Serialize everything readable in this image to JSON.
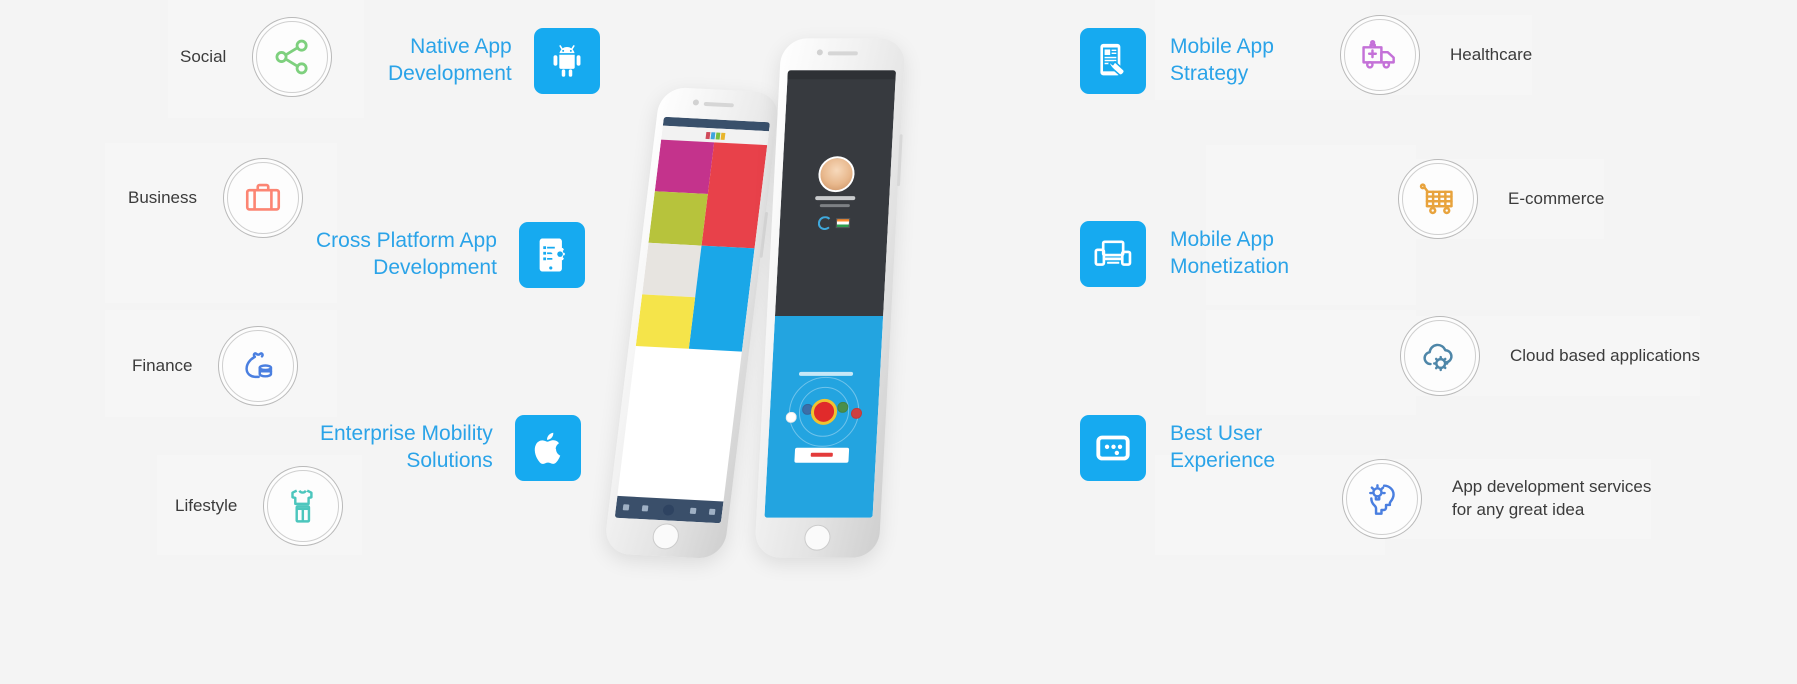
{
  "page": {
    "background_color": "#f4f4f4",
    "panel_color": "#f6f6f6",
    "accent_blue": "#16aaf0",
    "link_blue": "#2aa3e8",
    "label_color": "#3b3b3b"
  },
  "industries": {
    "left": [
      {
        "label": "Social",
        "icon": "share-nodes-icon",
        "icon_color": "#7ed07e"
      },
      {
        "label": "Business",
        "icon": "briefcase-icon",
        "icon_color": "#fc8573"
      },
      {
        "label": "Finance",
        "icon": "money-bag-icon",
        "icon_color": "#4a7fe0"
      },
      {
        "label": "Lifestyle",
        "icon": "clothing-icon",
        "icon_color": "#4cc6bd"
      }
    ],
    "right": [
      {
        "label": "Healthcare",
        "icon": "ambulance-icon",
        "icon_color": "#c471d8"
      },
      {
        "label": "E-commerce",
        "icon": "shopping-cart-icon",
        "icon_color": "#e8a33d"
      },
      {
        "label": "Cloud based applications",
        "icon": "cloud-gear-icon",
        "icon_color": "#4e86a8"
      },
      {
        "label": "App development services\nfor any great idea",
        "icon": "head-lightbulb-icon",
        "icon_color": "#4a7fe0"
      }
    ]
  },
  "services": {
    "left": [
      {
        "label": "Native App\nDevelopment",
        "icon": "android-icon"
      },
      {
        "label": "Cross Platform App\nDevelopment",
        "icon": "phone-gear-icon"
      },
      {
        "label": "Enterprise Mobility\nSolutions",
        "icon": "apple-icon"
      }
    ],
    "right": [
      {
        "label": "Mobile App\nStrategy",
        "icon": "phone-hand-icon"
      },
      {
        "label": "Mobile App\nMonetization",
        "icon": "multi-device-icon"
      },
      {
        "label": "Best User\nExperience",
        "icon": "window-dots-icon"
      }
    ]
  },
  "phones": {
    "left_phone": {
      "name": "android-phone-mockup",
      "app": "category-tiles-app"
    },
    "right_phone": {
      "name": "iphone-mockup",
      "app": "profile-radar-app"
    }
  }
}
